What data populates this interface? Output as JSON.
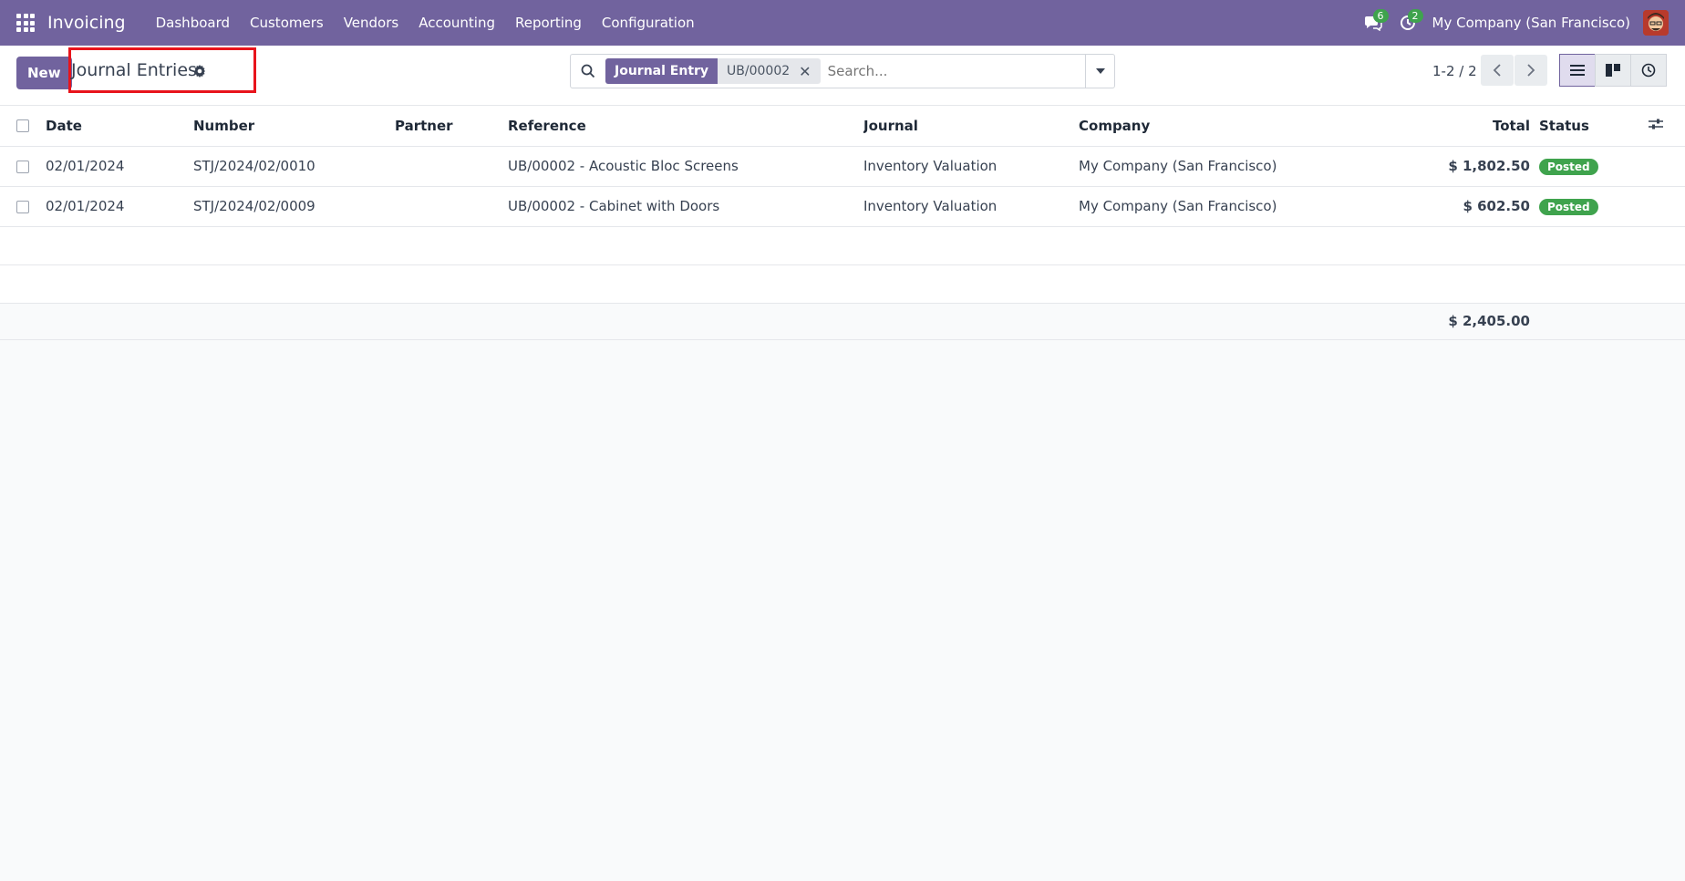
{
  "navbar": {
    "brand": "Invoicing",
    "menu": [
      "Dashboard",
      "Customers",
      "Vendors",
      "Accounting",
      "Reporting",
      "Configuration"
    ],
    "messages_count": "6",
    "activities_count": "2",
    "company": "My Company (San Francisco)"
  },
  "control_panel": {
    "new_label": "New",
    "title": "Journal Entries",
    "search": {
      "facet_label": "Journal Entry",
      "facet_value": "UB/00002",
      "placeholder": "Search..."
    },
    "pager": "1-2 / 2"
  },
  "table": {
    "columns": [
      "Date",
      "Number",
      "Partner",
      "Reference",
      "Journal",
      "Company",
      "Total",
      "Status"
    ],
    "rows": [
      {
        "date": "02/01/2024",
        "number": "STJ/2024/02/0010",
        "partner": "",
        "reference": "UB/00002 - Acoustic Bloc Screens",
        "journal": "Inventory Valuation",
        "company": "My Company (San Francisco)",
        "total": "$ 1,802.50",
        "status": "Posted"
      },
      {
        "date": "02/01/2024",
        "number": "STJ/2024/02/0009",
        "partner": "",
        "reference": "UB/00002 - Cabinet with Doors",
        "journal": "Inventory Valuation",
        "company": "My Company (San Francisco)",
        "total": "$ 602.50",
        "status": "Posted"
      }
    ],
    "grand_total": "$ 2,405.00"
  },
  "colors": {
    "brand": "#71639e",
    "status_posted": "#3fa34d",
    "highlight": "#e8141c"
  }
}
